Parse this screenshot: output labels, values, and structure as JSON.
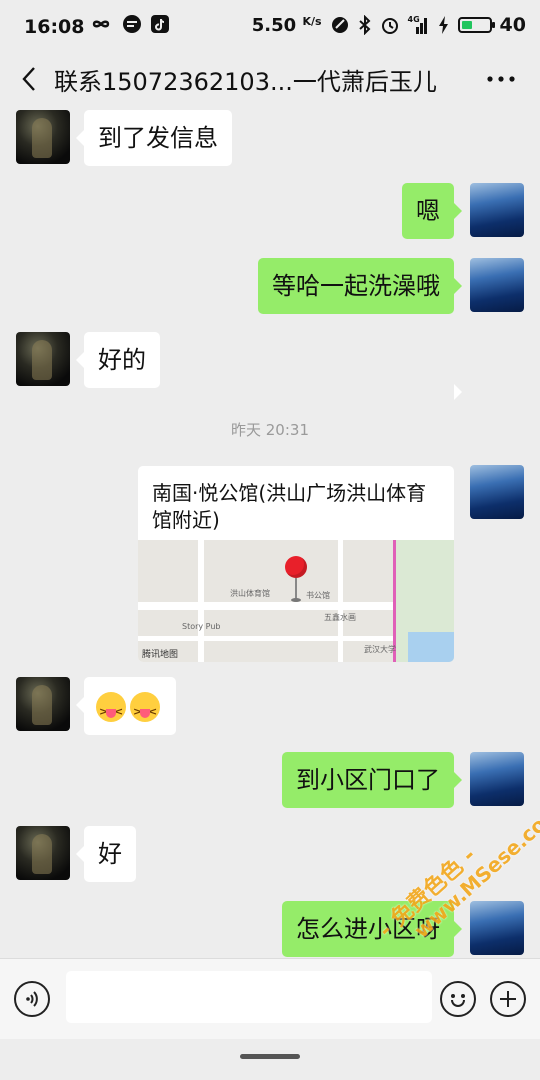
{
  "status_bar": {
    "time": "16:08",
    "net_speed": "5.50",
    "net_speed_unit": "K/s",
    "network_badge": "4G",
    "battery_level": 40,
    "battery_text": "40",
    "battery_color": "#22c55e"
  },
  "nav": {
    "title": "联系15072362103...一代萧后玉儿"
  },
  "messages": [
    {
      "side": "in",
      "text": "到了发信息"
    },
    {
      "side": "out",
      "text": "嗯"
    },
    {
      "side": "out",
      "text": "等哈一起洗澡哦"
    },
    {
      "side": "in",
      "text": "好的"
    },
    {
      "side": "out",
      "type": "location",
      "text": "南国·悦公馆(洪山广场洪山体育馆附近)"
    },
    {
      "side": "in",
      "type": "emoji",
      "text": ""
    },
    {
      "side": "out",
      "text": "到小区门口了"
    },
    {
      "side": "in",
      "text": "好"
    },
    {
      "side": "out",
      "text": "怎么进小区呀"
    }
  ],
  "timestamp": "昨天 20:31",
  "location_card": {
    "title": "南国·悦公馆(洪山广场洪山体育馆附近)",
    "map_provider": "腾讯地图",
    "map_labels": [
      "洪山体育馆",
      "书公馆",
      "五鑫水画",
      "Story Pub",
      "武汉大学"
    ]
  },
  "colors": {
    "background": "#ededed",
    "incoming_bubble": "#ffffff",
    "outgoing_bubble": "#95ec69",
    "timestamp_text": "#9a9a9a",
    "watermark": "#f3a81c"
  },
  "input": {
    "value": "",
    "placeholder": ""
  },
  "watermark": {
    "line1": "- 免费色色 -",
    "line2": "www.MSese.com"
  },
  "icons": {
    "back": "chevron-left-icon",
    "more": "more-dots-icon",
    "voice": "voice-icon",
    "emoji": "emoji-icon",
    "plus": "plus-icon"
  }
}
